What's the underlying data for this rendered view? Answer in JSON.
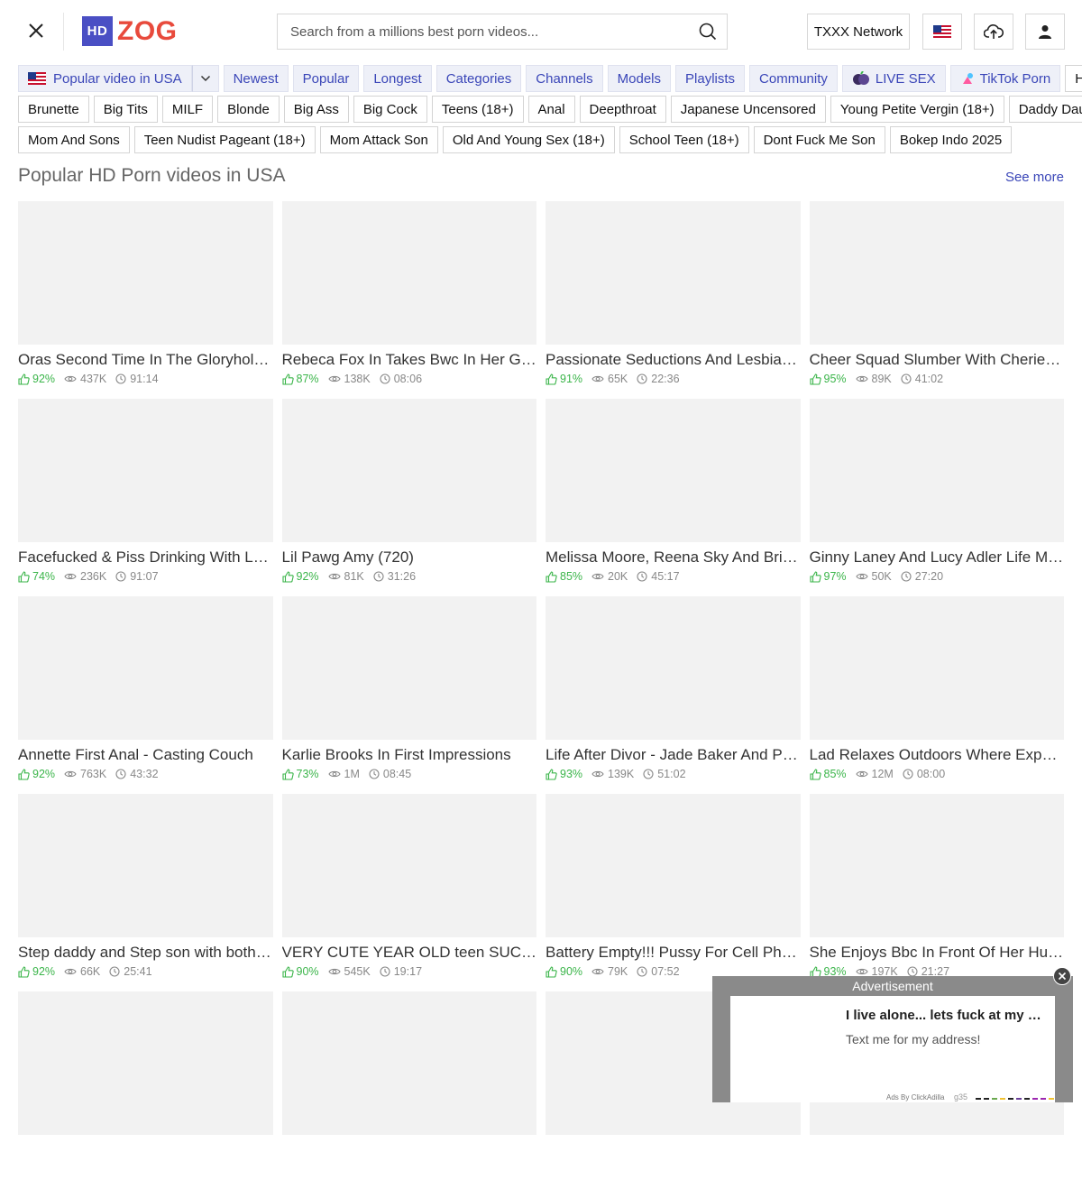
{
  "header": {
    "logo_hd": "HD",
    "logo_zog": "ZOG",
    "search_placeholder": "Search from a millions best porn videos...",
    "network_label": "TXXX Network",
    "icons": [
      "close-icon",
      "search-icon",
      "us-flag-icon",
      "upload-icon",
      "user-icon"
    ]
  },
  "nav": {
    "country_label": "Popular video in USA",
    "items": [
      "Newest",
      "Popular",
      "Longest",
      "Categories",
      "Channels",
      "Models",
      "Playlists",
      "Community",
      "LIVE SEX",
      "TikTok Porn"
    ],
    "hd_label": "HD"
  },
  "tags_row1": [
    "Brunette",
    "Big Tits",
    "MILF",
    "Blonde",
    "Big Ass",
    "Big Cock",
    "Teens (18+)",
    "Anal",
    "Deepthroat",
    "Japanese Uncensored",
    "Young Petite Vergin (18+)",
    "Daddy Daughter"
  ],
  "tags_row2": [
    "Mom And Sons",
    "Teen Nudist Pageant (18+)",
    "Mom Attack Son",
    "Old And Young Sex (18+)",
    "School Teen (18+)",
    "Dont Fuck Me Son",
    "Bokep Indo 2025"
  ],
  "section": {
    "title": "Popular HD Porn videos in USA",
    "see_more": "See more"
  },
  "videos": [
    {
      "title": "Oras Second Time In The Gloryhole - Gloryhole Secrets",
      "rating": "92%",
      "views": "437K",
      "duration": "91:14"
    },
    {
      "title": "Rebeca Fox In Takes Bwc In Her Gritty Hole",
      "rating": "87%",
      "views": "138K",
      "duration": "08:06"
    },
    {
      "title": "Passionate Seductions And Lesbian Pleasures",
      "rating": "91%",
      "views": "65K",
      "duration": "22:36"
    },
    {
      "title": "Cheer Squad Slumber With Cherie DeVille",
      "rating": "95%",
      "views": "89K",
      "duration": "41:02"
    },
    {
      "title": "Facefucked & Piss Drinking With Lana Rhoades",
      "rating": "74%",
      "views": "236K",
      "duration": "91:07"
    },
    {
      "title": "Lil Pawg Amy (720)",
      "rating": "92%",
      "views": "81K",
      "duration": "31:26"
    },
    {
      "title": "Melissa Moore, Reena Sky And Brianna Love",
      "rating": "85%",
      "views": "20K",
      "duration": "45:17"
    },
    {
      "title": "Ginny Laney And Lucy Adler Life Matte",
      "rating": "97%",
      "views": "50K",
      "duration": "27:20"
    },
    {
      "title": "Annette First Anal - Casting Couch",
      "rating": "92%",
      "views": "763K",
      "duration": "43:32"
    },
    {
      "title": "Karlie Brooks In First Impressions",
      "rating": "73%",
      "views": "1M",
      "duration": "08:45"
    },
    {
      "title": "Life After Divor - Jade Baker And Peter Green",
      "rating": "93%",
      "views": "139K",
      "duration": "51:02"
    },
    {
      "title": "Lad Relaxes Outdoors Where Experienced Lady",
      "rating": "85%",
      "views": "12M",
      "duration": "08:00"
    },
    {
      "title": "Step daddy and Step son with both cocks",
      "rating": "92%",
      "views": "66K",
      "duration": "25:41"
    },
    {
      "title": "VERY CUTE YEAR OLD teen SUCKING DICK",
      "rating": "90%",
      "views": "545K",
      "duration": "19:17"
    },
    {
      "title": "Battery Empty!!! Pussy For Cell Phone Charge",
      "rating": "90%",
      "views": "79K",
      "duration": "07:52"
    },
    {
      "title": "She Enjoys Bbc In Front Of Her Husband",
      "rating": "93%",
      "views": "197K",
      "duration": "21:27"
    },
    {
      "title": "",
      "rating": "",
      "views": "",
      "duration": ""
    },
    {
      "title": "",
      "rating": "",
      "views": "",
      "duration": ""
    },
    {
      "title": "",
      "rating": "",
      "views": "",
      "duration": ""
    },
    {
      "title": "",
      "rating": "",
      "views": "",
      "duration": ""
    }
  ],
  "ad": {
    "label": "Advertisement",
    "title": "I live alone... lets fuck at my place",
    "text": "Text me for my address!",
    "footer": "Ads By ClickAdilla",
    "code": "g35"
  },
  "colors": {
    "brand_blue": "#4a4fc4",
    "brand_red": "#e84a3c",
    "link_blue": "#3a46b8",
    "rating_green": "#3bb54a"
  }
}
